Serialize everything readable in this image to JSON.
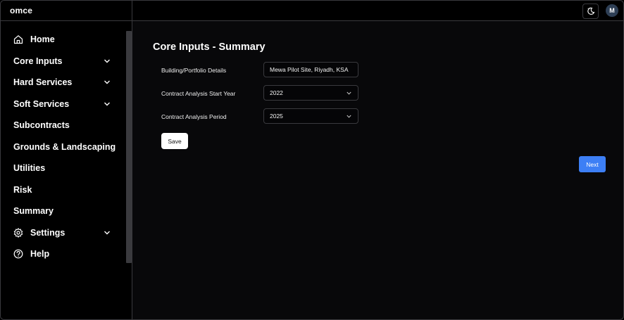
{
  "app": {
    "brand": "omce",
    "avatar_initial": "M",
    "theme_toggle_icon": "moon-sun-icon"
  },
  "sidebar": {
    "items": [
      {
        "label": "Home",
        "icon": "home-icon"
      },
      {
        "label": "Core Inputs",
        "has_children": true
      },
      {
        "label": "Hard Services",
        "has_children": true
      },
      {
        "label": "Soft Services",
        "has_children": true
      },
      {
        "label": "Subcontracts"
      },
      {
        "label": "Grounds & Landscaping"
      },
      {
        "label": "Utilities"
      },
      {
        "label": "Risk"
      },
      {
        "label": "Summary"
      },
      {
        "label": "Settings",
        "icon": "gear-icon",
        "has_children": true
      },
      {
        "label": "Help",
        "icon": "help-circle-icon"
      }
    ]
  },
  "main": {
    "title": "Core Inputs - Summary",
    "fields": [
      {
        "label": "Building/Portfolio Details",
        "value": "Mewa Pilot Site, Riyadh, KSA",
        "type": "text"
      },
      {
        "label": "Contract Analysis Start Year",
        "value": "2022",
        "type": "select"
      },
      {
        "label": "Contract Analysis Period",
        "value": "2025",
        "type": "select"
      }
    ],
    "save_label": "Save",
    "next_label": "Next"
  },
  "colors": {
    "background": "#08080a",
    "border": "#3a3a3e",
    "accent": "#3d7ff5",
    "avatar_bg": "#2e3f55"
  }
}
